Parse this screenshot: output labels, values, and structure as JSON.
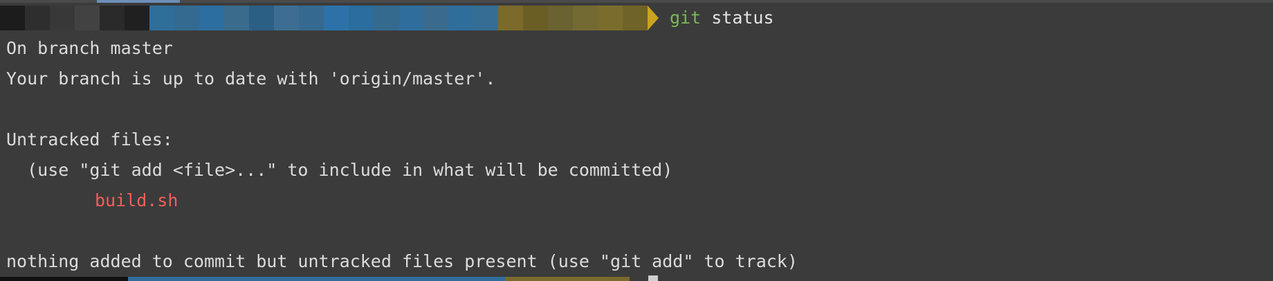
{
  "prompt": {
    "command": "git",
    "argument": "status",
    "redacted_segment_colors": [
      "#1c1c1c",
      "#2e2e2e",
      "#383838",
      "#424242",
      "#2a2a2a",
      "#202020",
      "#2f6e99",
      "#346a90",
      "#2d6ea0",
      "#3a6a8c",
      "#2b5f84",
      "#3d6d92",
      "#35698f",
      "#2c72a8",
      "#2a6d9e",
      "#356a8f",
      "#2f6e9c",
      "#3a6b8e",
      "#2f6d9b",
      "#356d94",
      "#7b6a2a",
      "#6b5e25",
      "#6a6230",
      "#736a33",
      "#7a6c2c",
      "#6f6327"
    ],
    "arrow_color": "#c9a41e",
    "git_color": "#7bb85a"
  },
  "output": {
    "line1": "On branch master",
    "line2": "Your branch is up to date with 'origin/master'.",
    "line3": "Untracked files:",
    "line4": "  (use \"git add <file>...\" to include in what will be committed)",
    "untracked_file": "build.sh",
    "line6": "nothing added to commit but untracked files present (use \"git add\" to track)"
  },
  "colors": {
    "background": "#3b3b3b",
    "text": "#dcdcdc",
    "untracked": "#f0605a"
  }
}
